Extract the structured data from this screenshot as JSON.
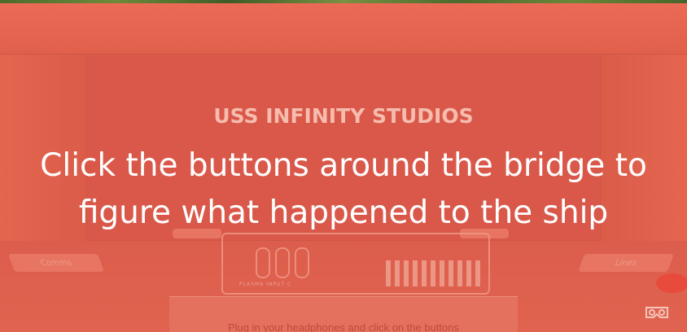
{
  "studio_name": "USS INFINITY STUDIOS",
  "headline_line1": "Click the buttons around the bridge to",
  "headline_line2": "figure what happened to the ship",
  "bottom_hint": "Plug in your headphones and click on the buttons",
  "left_pad_label": "Comms",
  "right_pad_label": "Lines",
  "console_label": "PLASMA INPUT C",
  "icons": {
    "vr": "vr-headset-icon"
  },
  "colors": {
    "overlay": "#c8513f",
    "headline": "#ffffff",
    "studio": "#f6bcae"
  }
}
